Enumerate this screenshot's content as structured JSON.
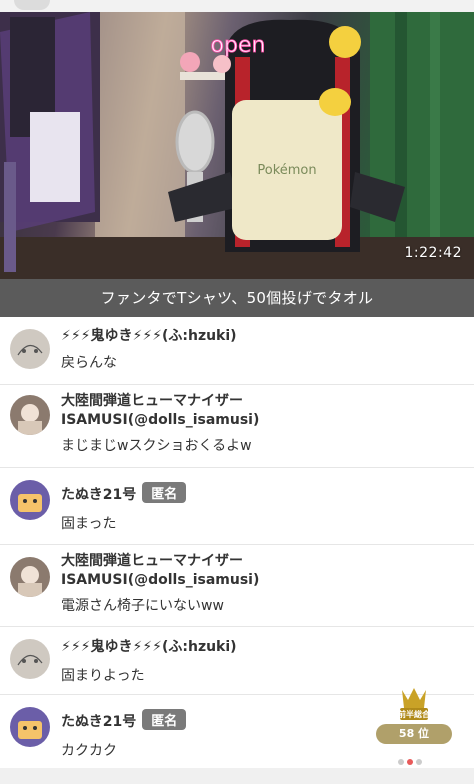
{
  "video": {
    "timestamp": "1:22:42",
    "neon_sign": "open",
    "pillow_text": "Pokémon"
  },
  "caption": "ファンタでTシャツ、50個投げでタオル",
  "comments": [
    {
      "name": "⚡⚡⚡鬼ゆき⚡⚡⚡(ふ:hzuki)",
      "message": "戻らんな",
      "badge": ""
    },
    {
      "name_line1": "大陸間弾道ヒューマナイザー",
      "name_line2": "ISAMUSI(@dolls_isamusi)",
      "message": "まじまじwスクショおくるよw",
      "badge": ""
    },
    {
      "name": "たぬき21号",
      "message": "固まった",
      "badge": "匿名"
    },
    {
      "name_line1": "大陸間弾道ヒューマナイザー",
      "name_line2": "ISAMUSI(@dolls_isamusi)",
      "message": "電源さん椅子にいないww",
      "badge": ""
    },
    {
      "name": "⚡⚡⚡鬼ゆき⚡⚡⚡(ふ:hzuki)",
      "message": "固まりよった",
      "badge": ""
    },
    {
      "name": "たぬき21号",
      "message": "カクカク",
      "badge": "匿名"
    }
  ],
  "rank": {
    "label": "前半総合",
    "position": "58 位"
  },
  "colors": {
    "caption_bg": "#5b5b5b",
    "badge_bg": "#7a7a7a",
    "rank_gold": "#b0a06a"
  }
}
